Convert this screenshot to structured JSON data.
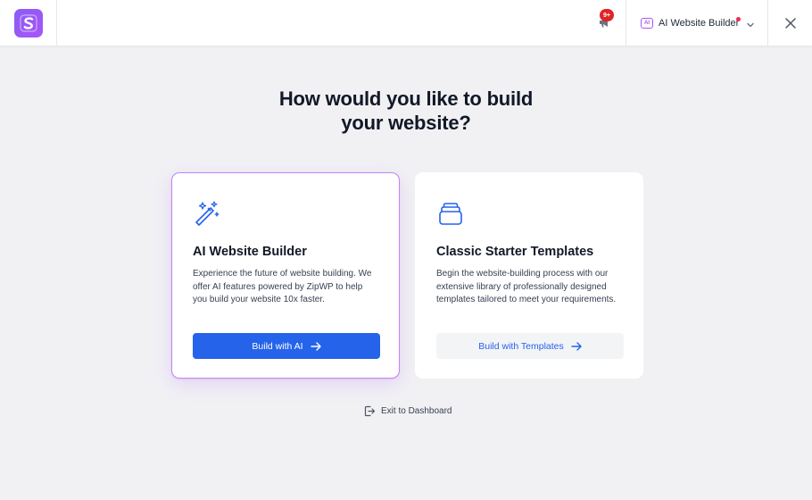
{
  "header": {
    "notification_count": "9+",
    "builder_chip": "AI",
    "builder_label": "AI Website Builder"
  },
  "main": {
    "title_line1": "How would you like to build",
    "title_line2": "your website?"
  },
  "cards": [
    {
      "title": "AI Website Builder",
      "description": "Experience the future of website building. We offer AI features powered by ZipWP to help you build your website 10x faster.",
      "button_label": "Build with AI",
      "icon": "magic-wand-icon"
    },
    {
      "title": "Classic Starter Templates",
      "description": "Begin the website-building process with our extensive library of professionally designed templates tailored to meet your requirements.",
      "button_label": "Build with Templates",
      "icon": "stacked-layers-icon"
    }
  ],
  "footer": {
    "exit_label": "Exit to Dashboard"
  },
  "colors": {
    "primary": "#2563eb",
    "accent": "#a855f7",
    "badge": "#dc2626",
    "background": "#f1f1f4"
  }
}
